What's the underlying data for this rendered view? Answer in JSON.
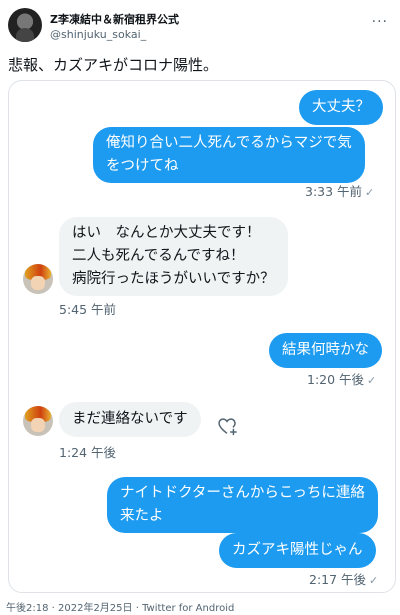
{
  "author": {
    "name": "Z李凍結中＆新宿租界公式",
    "handle": "@shinjuku_sokai_",
    "more_label": "..."
  },
  "tweet": {
    "text": "悲報、カズアキがコロナ陽性。"
  },
  "chat": {
    "msg1": "大丈夫？",
    "msg2_line1": "俺知り合い二人死んでるからマジで気",
    "msg2_line2": "をつけてね",
    "time1": "3:33 午前",
    "msg3_line1": "はい　なんとか大丈夫です！",
    "msg3_line2": "二人も死んでるんですね！",
    "msg3_line3": "病院行ったほうがいいですか？",
    "time2": "5:45 午前",
    "msg4": "結果何時かな",
    "time3": "1:20 午後",
    "msg5": "まだ連絡ないです",
    "time4": "1:24 午後",
    "msg6_line1": "ナイトドクターさんからこっちに連絡",
    "msg6_line2": "来たよ",
    "msg7": "カズアキ陽性じゃん",
    "time5": "2:17 午後",
    "check": "✓"
  },
  "footer": {
    "text": "午後2:18 · 2022年2月25日 · Twitter for Android"
  }
}
